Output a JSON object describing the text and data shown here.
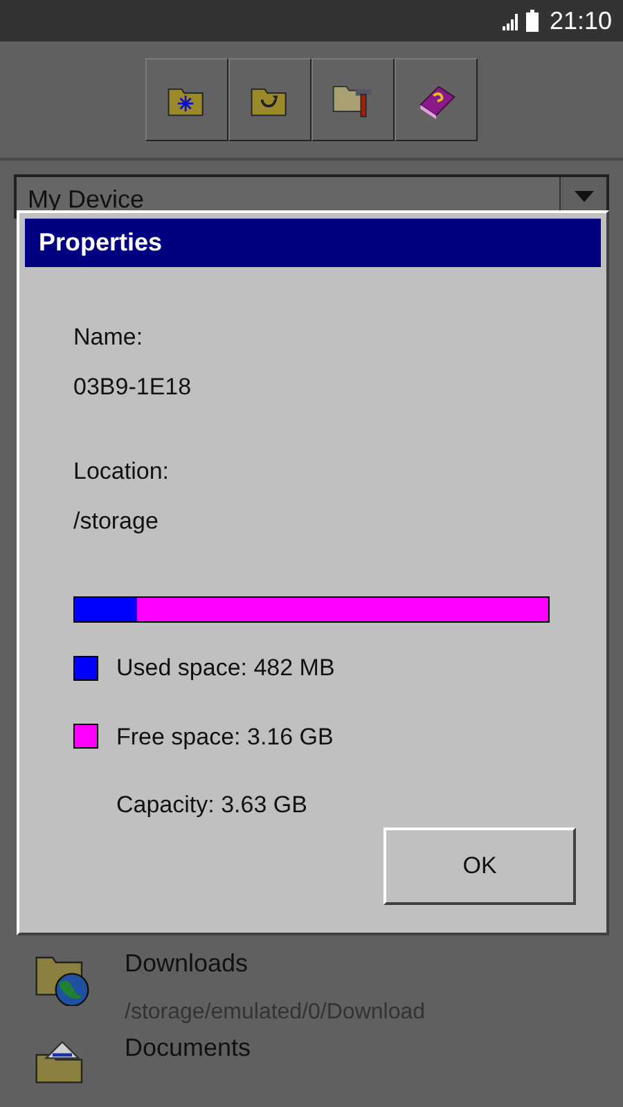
{
  "status_bar": {
    "time": "21:10"
  },
  "toolbar": {
    "buttons": [
      {
        "kind": "new-folder"
      },
      {
        "kind": "refresh"
      },
      {
        "kind": "tools"
      },
      {
        "kind": "help"
      }
    ]
  },
  "location_dropdown": {
    "value": "My Device"
  },
  "dialog": {
    "title": "Properties",
    "fields": [
      {
        "label": "Name:",
        "value": "03B9-1E18"
      },
      {
        "label": "Location:",
        "value": "/storage"
      }
    ],
    "usage": {
      "level": 0.133
    },
    "legend": [
      {
        "text": "Used space: 482 MB",
        "color": "#0000ff"
      },
      {
        "text": "Free space: 3.16 GB",
        "color": "#ff00ff"
      }
    ],
    "capacity": "Capacity: 3.63 GB",
    "button": "OK"
  },
  "list": [
    {
      "kind": "globe",
      "title": "Downloads",
      "path": "/storage/emulated/0/Download"
    },
    {
      "kind": "documents",
      "title": "Documents"
    }
  ]
}
